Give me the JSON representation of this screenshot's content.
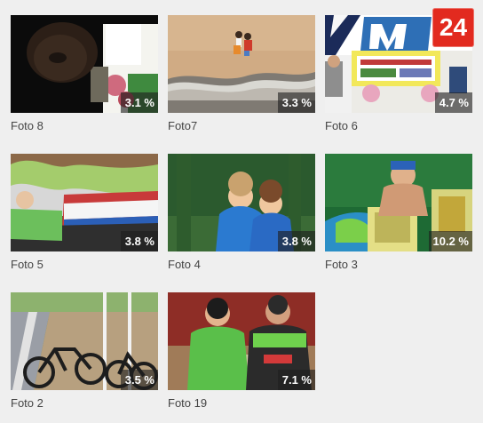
{
  "site": {
    "logo_text": "24",
    "accent": "#e22a1f"
  },
  "gallery": {
    "items": [
      {
        "caption": "Foto 8",
        "percent": "3.1 %"
      },
      {
        "caption": "Foto7",
        "percent": "3.3 %"
      },
      {
        "caption": "Foto 6",
        "percent": "4.7 %"
      },
      {
        "caption": "Foto 5",
        "percent": "3.8 %"
      },
      {
        "caption": "Foto 4",
        "percent": "3.8 %"
      },
      {
        "caption": "Foto 3",
        "percent": "10.2 %"
      },
      {
        "caption": "Foto 2",
        "percent": "3.5 %"
      },
      {
        "caption": "Foto 19",
        "percent": "7.1 %"
      }
    ]
  }
}
